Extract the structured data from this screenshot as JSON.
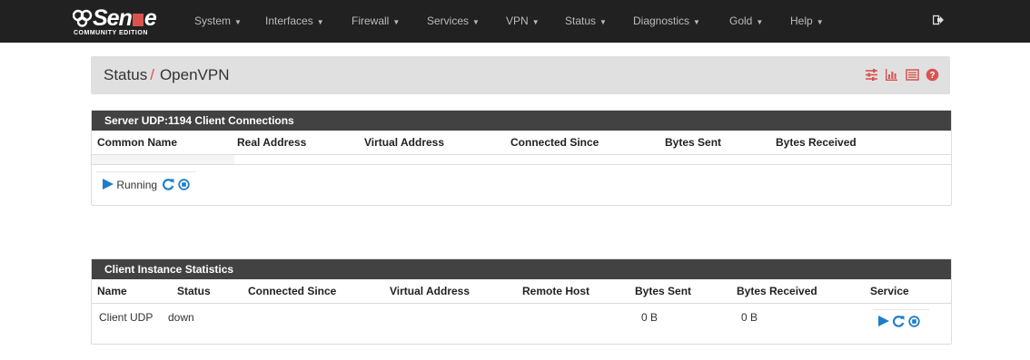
{
  "brand": {
    "name_part1": "Sen",
    "name_part2": "e",
    "edition": "COMMUNITY EDITION"
  },
  "nav": {
    "items": [
      "System",
      "Interfaces",
      "Firewall",
      "Services",
      "VPN",
      "Status",
      "Diagnostics",
      "Gold",
      "Help"
    ],
    "logout_icon": "sign-out-icon"
  },
  "header": {
    "breadcrumb_parent": "Status",
    "separator": "/",
    "breadcrumb_current": "OpenVPN",
    "icons": [
      "sliders-icon",
      "bar-chart-icon",
      "list-icon",
      "help-icon"
    ]
  },
  "server_panel": {
    "title": "Server UDP:1194 Client Connections",
    "columns": [
      "Common Name",
      "Real Address",
      "Virtual Address",
      "Connected Since",
      "Bytes Sent",
      "Bytes Received"
    ],
    "service_status": "Running",
    "service_icons": [
      "play-icon",
      "restart-icon",
      "stop-icon"
    ]
  },
  "client_panel": {
    "title": "Client Instance Statistics",
    "columns": [
      "Name",
      "Status",
      "Connected Since",
      "Virtual Address",
      "Remote Host",
      "Bytes Sent",
      "Bytes Received",
      "Service"
    ],
    "rows": [
      {
        "name": "Client UDP",
        "status": "down",
        "connected_since": "",
        "virtual_address": "",
        "remote_host": "",
        "bytes_sent": "0 B",
        "bytes_received": "0 B"
      }
    ],
    "service_icons": [
      "play-icon",
      "restart-icon",
      "stop-icon"
    ]
  },
  "colors": {
    "navbar": "#212121",
    "panel_heading": "#424242",
    "accent_red": "#d9534f",
    "icon_blue": "#1e7ec8"
  }
}
